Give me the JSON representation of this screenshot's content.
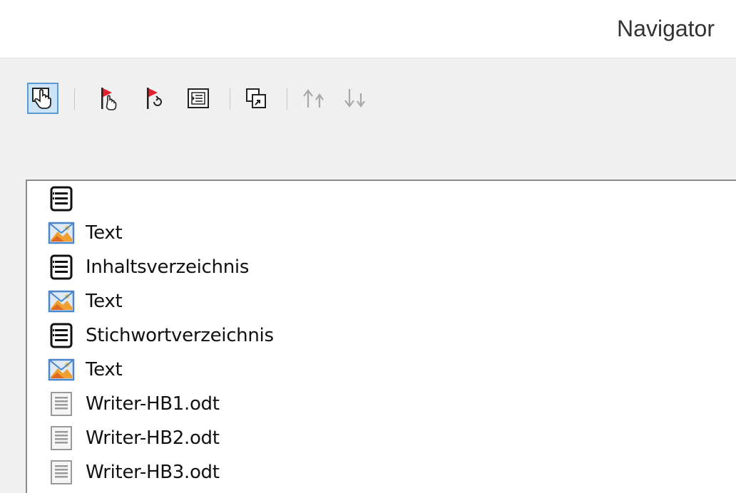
{
  "window": {
    "title": "Navigator"
  },
  "toolbar": {
    "buttons": [
      {
        "icon": "content-view-hand-icon",
        "active": true
      },
      {
        "icon": "set-reminder-flag-icon"
      },
      {
        "icon": "navigate-reminder-flag-icon"
      },
      {
        "icon": "list-box-icon"
      },
      {
        "icon": "drag-mode-icon"
      },
      {
        "icon": "promote-up-arrows-icon",
        "disabled": true
      },
      {
        "icon": "demote-down-arrows-icon",
        "disabled": true
      }
    ]
  },
  "tree": {
    "items": [
      {
        "icon": "index-icon",
        "label": ""
      },
      {
        "icon": "text-section-icon",
        "label": "Text"
      },
      {
        "icon": "index-icon",
        "label": "Inhaltsverzeichnis"
      },
      {
        "icon": "text-section-icon",
        "label": "Text"
      },
      {
        "icon": "index-icon",
        "label": "Stichwortverzeichnis"
      },
      {
        "icon": "text-section-icon",
        "label": "Text"
      },
      {
        "icon": "document-file-icon",
        "label": "Writer-HB1.odt"
      },
      {
        "icon": "document-file-icon",
        "label": "Writer-HB2.odt"
      },
      {
        "icon": "document-file-icon",
        "label": "Writer-HB3.odt"
      }
    ]
  },
  "colors": {
    "active_button_bg": "#cce4f7",
    "active_button_border": "#5a9bd4",
    "flag_red": "#e0232d",
    "text_icon_blue": "#4a86c8",
    "text_icon_orange": "#f0a030"
  }
}
